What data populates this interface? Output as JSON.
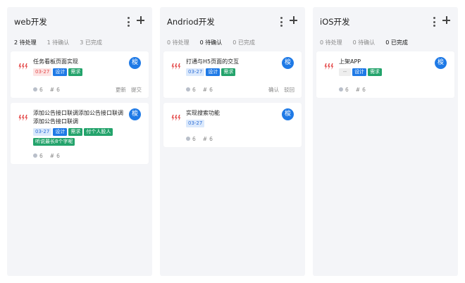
{
  "columns": [
    {
      "title": "web开发",
      "tabs": [
        "2 待处理",
        "1 待确认",
        "3 已完成"
      ],
      "active_tab": 0,
      "cards": [
        {
          "title": "任务看板页面实现",
          "avatar": "梭",
          "tags": [
            {
              "text": "03-27",
              "kind": "date-red"
            },
            {
              "text": "设计",
              "kind": "design"
            },
            {
              "text": "需求",
              "kind": "green"
            }
          ],
          "comments": "6",
          "refs": "6",
          "actions": [
            "更新",
            "提交"
          ]
        },
        {
          "title": "添加公告接口联调添加公告接口联调添加公告接口联调",
          "avatar": "梭",
          "tags": [
            {
              "text": "03-27",
              "kind": "date-blue"
            },
            {
              "text": "设计",
              "kind": "design"
            },
            {
              "text": "需求",
              "kind": "green"
            },
            {
              "text": "付个人股人",
              "kind": "green"
            },
            {
              "text": "听说最长8个字呢",
              "kind": "green"
            }
          ],
          "comments": "6",
          "refs": "6",
          "actions": []
        }
      ]
    },
    {
      "title": "Andriod开发",
      "tabs": [
        "0 待处理",
        "0 待确认",
        "0 已完成"
      ],
      "active_tab": 1,
      "cards": [
        {
          "title": "打通与H5页面的交互",
          "avatar": "梭",
          "tags": [
            {
              "text": "03-27",
              "kind": "date-blue"
            },
            {
              "text": "设计",
              "kind": "design"
            },
            {
              "text": "需求",
              "kind": "green"
            }
          ],
          "comments": "6",
          "refs": "6",
          "actions": [
            "确认",
            "驳回"
          ]
        },
        {
          "title": "实现搜索功能",
          "avatar": "梭",
          "tags": [
            {
              "text": "03-27",
              "kind": "date-blue"
            }
          ],
          "comments": "6",
          "refs": "6",
          "actions": []
        }
      ]
    },
    {
      "title": "iOS开发",
      "tabs": [
        "0 待处理",
        "0 待确认",
        "0 已完成"
      ],
      "active_tab": 2,
      "cards": [
        {
          "title": "上架APP",
          "avatar": "梭",
          "tags": [
            {
              "text": "--",
              "kind": "date-grey"
            },
            {
              "text": "设计",
              "kind": "design"
            },
            {
              "text": "需求",
              "kind": "green"
            }
          ],
          "comments": "6",
          "refs": "6",
          "actions": []
        }
      ]
    }
  ],
  "colors": {
    "column_bg": "#f4f5f8",
    "avatar": "#1f7ae6",
    "priority": "#e23b3b",
    "design_tag": "#1f7ae6",
    "green_tag": "#23a36b"
  },
  "icons": {
    "priority": "priority-lightning-icon",
    "menu": "more-vertical-icon",
    "add": "plus-icon",
    "comment": "comment-icon",
    "hash": "hash-icon"
  }
}
